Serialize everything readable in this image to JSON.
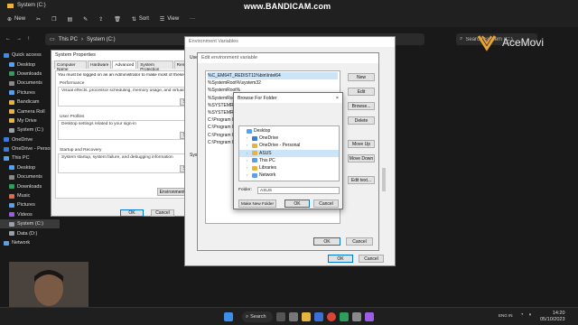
{
  "watermark": "www.BANDICAM.com",
  "explorer": {
    "window_title": "System (C:)",
    "toolbar": {
      "new": "New",
      "sort": "Sort",
      "view": "View",
      "more": "···"
    },
    "breadcrumb": [
      "This PC",
      "System (C:)"
    ],
    "search_placeholder": "Search System (C:)"
  },
  "sidebar": {
    "items": [
      {
        "label": "Quick access",
        "color": "#3b8eea"
      },
      {
        "label": "Desktop",
        "color": "#4aa3ff"
      },
      {
        "label": "Downloads",
        "color": "#2e9e5b"
      },
      {
        "label": "Documents",
        "color": "#8a8a8a"
      },
      {
        "label": "Pictures",
        "color": "#5aa0e8"
      },
      {
        "label": "Bandicam",
        "color": "#e8b440"
      },
      {
        "label": "Camera Roll",
        "color": "#e8b440"
      },
      {
        "label": "My Drive",
        "color": "#e8b440"
      },
      {
        "label": "System (C:)",
        "color": "#9aa0a6"
      },
      {
        "label": "OneDrive",
        "color": "#3a7bd5"
      },
      {
        "label": "OneDrive - Personal",
        "color": "#3a7bd5"
      },
      {
        "label": "This PC",
        "color": "#5aa0e8"
      },
      {
        "label": "Desktop",
        "color": "#4aa3ff"
      },
      {
        "label": "Documents",
        "color": "#8a8a8a"
      },
      {
        "label": "Downloads",
        "color": "#2e9e5b"
      },
      {
        "label": "Music",
        "color": "#e06a4a"
      },
      {
        "label": "Pictures",
        "color": "#5aa0e8"
      },
      {
        "label": "Videos",
        "color": "#9b5de5"
      },
      {
        "label": "System (C:)",
        "color": "#9aa0a6"
      },
      {
        "label": "Data (D:)",
        "color": "#9aa0a6"
      },
      {
        "label": "Network",
        "color": "#5aa0e8"
      }
    ]
  },
  "system_properties": {
    "title": "System Properties",
    "tabs": [
      "Computer Name",
      "Hardware",
      "Advanced",
      "System Protection",
      "Remote"
    ],
    "intro": "You must be logged on as an Administrator to make most of these ch",
    "performance_label": "Performance",
    "performance_text": "Visual effects, processor scheduling, memory usage, and virtual me",
    "profiles_label": "User Profiles",
    "profiles_text": "Desktop settings related to your sign-in",
    "startup_label": "Startup and Recovery",
    "startup_text": "System startup, system failure, and debugging information",
    "settings_btn": "Se",
    "env_btn": "Environment V",
    "ok": "OK",
    "cancel": "Cancel"
  },
  "env_vars": {
    "title": "Environment Variables",
    "user_label": "User",
    "system_label": "Syste",
    "ok": "OK",
    "cancel": "Cancel"
  },
  "edit_env": {
    "title": "Edit environment variable",
    "paths": [
      "%C_EM64T_REDIST11%bin\\Intel64",
      "%SystemRoot%\\system32",
      "%SystemRoot%",
      "%SystemRoot%\\S",
      "%SYSTEMROO",
      "%SYSTEMROO",
      "C:\\Program F",
      "C:\\Program F",
      "C:\\Program F",
      "C:\\Program F"
    ],
    "buttons": [
      "New",
      "Edit",
      "Browse...",
      "Delete",
      "Move Up",
      "Move Down",
      "Edit text..."
    ],
    "ok": "OK",
    "cancel": "Cancel"
  },
  "browse": {
    "title": "Browse For Folder",
    "close": "×",
    "tree": [
      {
        "label": "Desktop",
        "color": "#4aa3ff",
        "indent": 0
      },
      {
        "label": "OneDrive",
        "color": "#3a7bd5",
        "indent": 1
      },
      {
        "label": "OneDrive - Personal",
        "color": "#e8b440",
        "indent": 1
      },
      {
        "label": "ASUS",
        "color": "#e8b440",
        "indent": 1
      },
      {
        "label": "This PC",
        "color": "#5aa0e8",
        "indent": 1
      },
      {
        "label": "Libraries",
        "color": "#e8b440",
        "indent": 1
      },
      {
        "label": "Network",
        "color": "#5aa0e8",
        "indent": 1
      }
    ],
    "folder_label": "Folder:",
    "folder_value": "ASUS",
    "make_new_folder": "Make New Folder",
    "ok": "OK",
    "cancel": "Cancel"
  },
  "acemovi": {
    "name": "AceMovi"
  },
  "taskbar": {
    "search": "Search",
    "time": "14:20",
    "date": "05/10/2023",
    "lang": "ENG IN"
  }
}
